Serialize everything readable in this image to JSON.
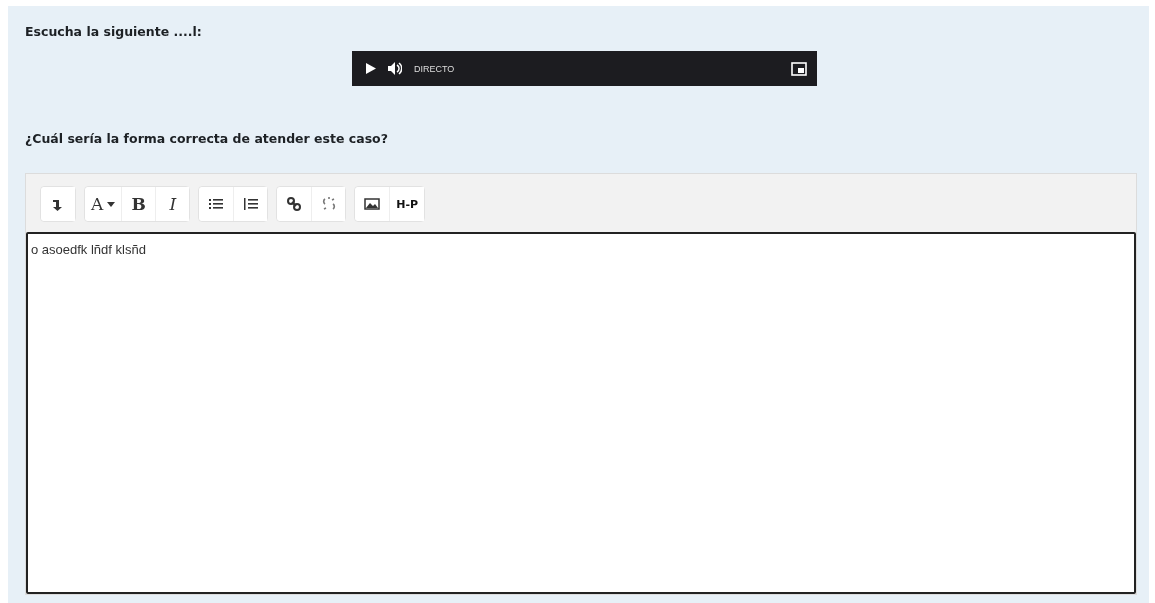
{
  "prompt": "Escucha la siguiente ....l:",
  "player": {
    "label": "DIRECTO"
  },
  "question": "¿Cuál sería la forma correcta de atender este caso?",
  "toolbar": [
    [
      {
        "kind": "collapse"
      }
    ],
    [
      {
        "kind": "font",
        "text": "A"
      },
      {
        "kind": "bold",
        "text": "B"
      },
      {
        "kind": "italic",
        "text": "I"
      }
    ],
    [
      {
        "kind": "bullets"
      },
      {
        "kind": "numbers"
      }
    ],
    [
      {
        "kind": "link"
      },
      {
        "kind": "unlink"
      }
    ],
    [
      {
        "kind": "image"
      },
      {
        "kind": "h5p",
        "text": "H-P"
      }
    ]
  ],
  "answer": {
    "value": "o asoedfk lñdf klsñd"
  }
}
